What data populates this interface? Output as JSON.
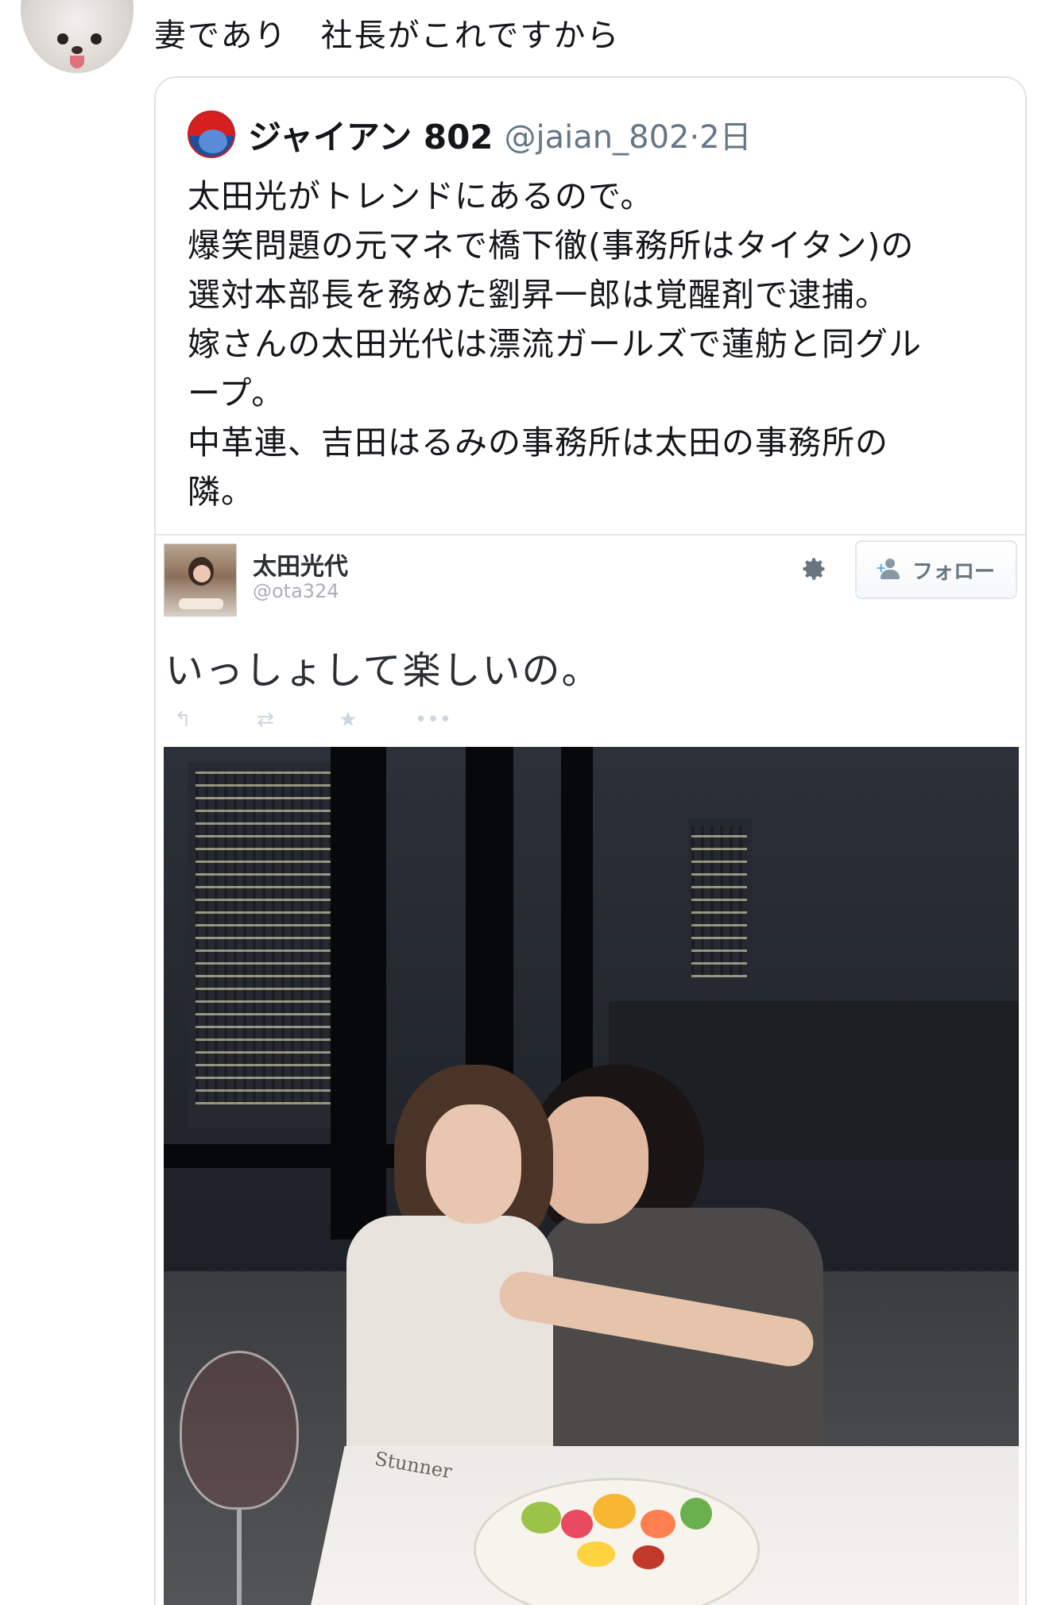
{
  "reply": {
    "text": "妻であり　社長がこれですから"
  },
  "quoted_tweet": {
    "display_name": "ジャイアン 802",
    "handle_time": "@jaian_802·2日",
    "body_lines": [
      "太田光がトレンドにあるので。",
      "爆笑問題の元マネで橋下徹(事務所はタイタン)の",
      "選対本部長を務めた劉昇一郎は覚醒剤で逮捕。",
      "嫁さんの太田光代は漂流ガールズで蓮舫と同グル",
      "ープ。",
      "中革連、吉田はるみの事務所は太田の事務所の",
      "隣。"
    ]
  },
  "embedded_tweet": {
    "display_name": "太田光代",
    "handle": "@ota324",
    "follow_label": "フォロー",
    "text": "いっしょして楽しいの。",
    "actions": [
      "reply-icon",
      "retweet-icon",
      "favorite-icon",
      "more-icon"
    ],
    "photo_text": "Stunner"
  },
  "colors": {
    "text_primary": "#14171a",
    "text_secondary": "#657786",
    "border": "#dfe3e6"
  }
}
